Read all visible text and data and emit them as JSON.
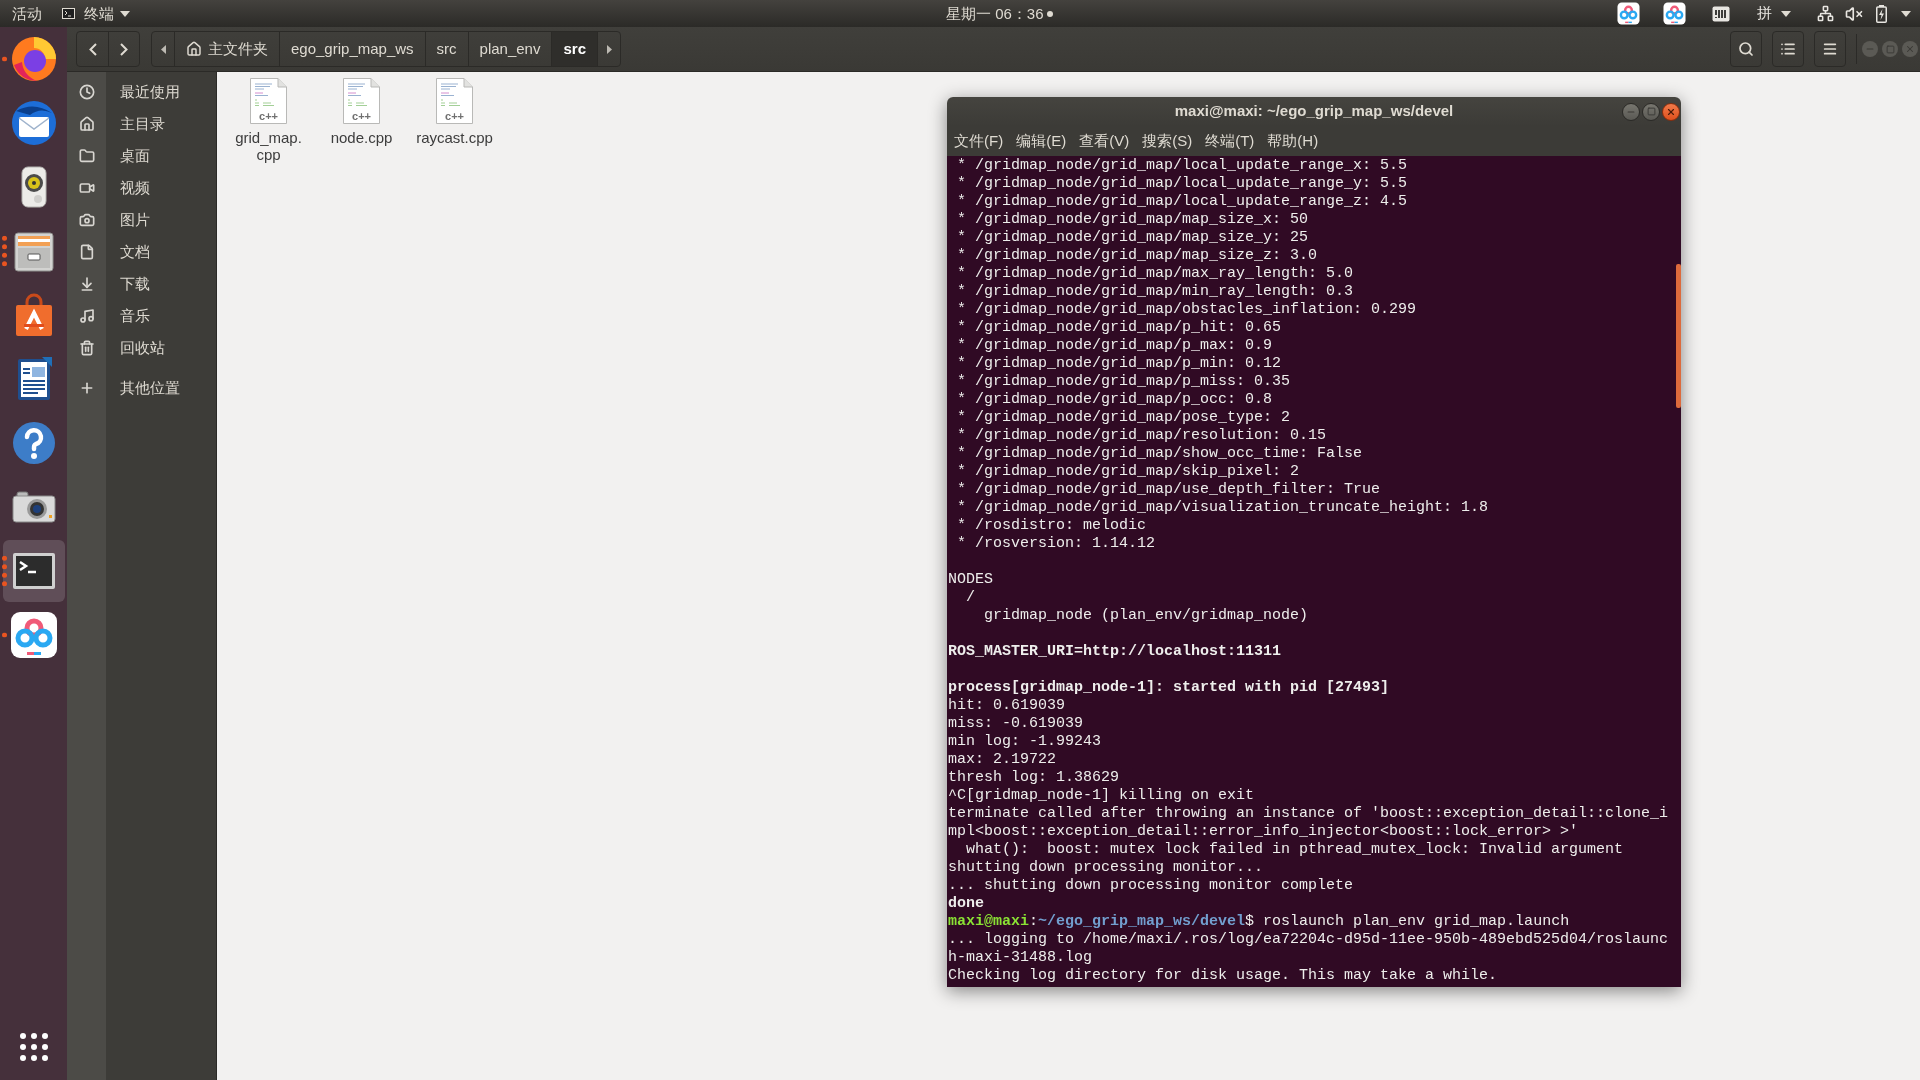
{
  "top_bar": {
    "activities": "活动",
    "app_menu": "终端",
    "clock": "星期一 06：36",
    "input_method": "拼"
  },
  "dock": {
    "apps": [
      {
        "kind": "browser",
        "running": true,
        "several_windows": false,
        "selected": false
      },
      {
        "kind": "mail",
        "running": false,
        "several_windows": false,
        "selected": false
      },
      {
        "kind": "music",
        "running": false,
        "several_windows": false,
        "selected": false
      },
      {
        "kind": "files",
        "running": true,
        "several_windows": true,
        "selected": false
      },
      {
        "kind": "software",
        "running": false,
        "several_windows": false,
        "selected": false
      },
      {
        "kind": "writer",
        "running": false,
        "several_windows": false,
        "selected": false
      },
      {
        "kind": "help",
        "running": false,
        "several_windows": false,
        "selected": false
      },
      {
        "kind": "camera",
        "running": false,
        "several_windows": false,
        "selected": false
      },
      {
        "kind": "terminal",
        "running": true,
        "several_windows": true,
        "selected": true
      },
      {
        "kind": "netdisk",
        "running": true,
        "several_windows": false,
        "selected": false
      }
    ]
  },
  "files_window": {
    "path": [
      {
        "label": "主文件夹",
        "kind": "home",
        "selected": false
      },
      {
        "label": "ego_grip_map_ws",
        "kind": "folder",
        "selected": false
      },
      {
        "label": "src",
        "kind": "folder",
        "selected": false
      },
      {
        "label": "plan_env",
        "kind": "folder",
        "selected": false
      },
      {
        "label": "src",
        "kind": "folder",
        "selected": true
      }
    ],
    "sidebar": {
      "items": [
        {
          "label": "最近使用",
          "kind": "recent",
          "selected": false
        },
        {
          "label": "主目录",
          "kind": "home",
          "selected": false
        },
        {
          "label": "桌面",
          "kind": "desktop",
          "selected": false
        },
        {
          "label": "视频",
          "kind": "videos",
          "selected": false
        },
        {
          "label": "图片",
          "kind": "pictures",
          "selected": false
        },
        {
          "label": "文档",
          "kind": "documents",
          "selected": false
        },
        {
          "label": "下载",
          "kind": "downloads",
          "selected": false
        },
        {
          "label": "音乐",
          "kind": "music",
          "selected": false
        },
        {
          "label": "回收站",
          "kind": "trash",
          "selected": false
        }
      ],
      "other_locations": {
        "label": "其他位置",
        "kind": "other",
        "selected": false
      }
    },
    "files": [
      {
        "name": "grid_map.cpp",
        "type_label": "c++"
      },
      {
        "name": "node.cpp",
        "type_label": "c++"
      },
      {
        "name": "raycast.cpp",
        "type_label": "c++"
      }
    ]
  },
  "terminal": {
    "title": "maxi@maxi: ~/ego_grip_map_ws/devel",
    "menu": [
      "文件(F)",
      "编辑(E)",
      "查看(V)",
      "搜索(S)",
      "终端(T)",
      "帮助(H)"
    ],
    "blocks": [
      [
        {
          "kind": "output",
          "text": " * /gridmap_node/grid_map/local_update_range_x: 5.5",
          "bold": false
        },
        {
          "kind": "output",
          "text": " * /gridmap_node/grid_map/local_update_range_y: 5.5",
          "bold": false
        },
        {
          "kind": "output",
          "text": " * /gridmap_node/grid_map/local_update_range_z: 4.5",
          "bold": false
        },
        {
          "kind": "output",
          "text": " * /gridmap_node/grid_map/map_size_x: 50",
          "bold": false
        },
        {
          "kind": "output",
          "text": " * /gridmap_node/grid_map/map_size_y: 25",
          "bold": false
        },
        {
          "kind": "output",
          "text": " * /gridmap_node/grid_map/map_size_z: 3.0",
          "bold": false
        },
        {
          "kind": "output",
          "text": " * /gridmap_node/grid_map/max_ray_length: 5.0",
          "bold": false
        },
        {
          "kind": "output",
          "text": " * /gridmap_node/grid_map/min_ray_length: 0.3",
          "bold": false
        },
        {
          "kind": "output",
          "text": " * /gridmap_node/grid_map/obstacles_inflation: 0.299",
          "bold": false
        },
        {
          "kind": "output",
          "text": " * /gridmap_node/grid_map/p_hit: 0.65",
          "bold": false
        },
        {
          "kind": "output",
          "text": " * /gridmap_node/grid_map/p_max: 0.9",
          "bold": false
        },
        {
          "kind": "output",
          "text": " * /gridmap_node/grid_map/p_min: 0.12",
          "bold": false
        },
        {
          "kind": "output",
          "text": " * /gridmap_node/grid_map/p_miss: 0.35",
          "bold": false
        },
        {
          "kind": "output",
          "text": " * /gridmap_node/grid_map/p_occ: 0.8",
          "bold": false
        },
        {
          "kind": "output",
          "text": " * /gridmap_node/grid_map/pose_type: 2",
          "bold": false
        },
        {
          "kind": "output",
          "text": " * /gridmap_node/grid_map/resolution: 0.15",
          "bold": false
        },
        {
          "kind": "output",
          "text": " * /gridmap_node/grid_map/show_occ_time: False",
          "bold": false
        },
        {
          "kind": "output",
          "text": " * /gridmap_node/grid_map/skip_pixel: 2",
          "bold": false
        },
        {
          "kind": "output",
          "text": " * /gridmap_node/grid_map/use_depth_filter: True",
          "bold": false
        },
        {
          "kind": "output",
          "text": " * /gridmap_node/grid_map/visualization_truncate_height: 1.8",
          "bold": false
        },
        {
          "kind": "output",
          "text": " * /rosdistro: melodic",
          "bold": false
        },
        {
          "kind": "output",
          "text": " * /rosversion: 1.14.12",
          "bold": false
        }
      ],
      [
        {
          "kind": "output",
          "text": "NODES",
          "bold": false,
          "children": [
            {
              "kind": "output",
              "text": "/",
              "bold": false,
              "children": [
                {
                  "kind": "output",
                  "text": "gridmap_node (plan_env/gridmap_node)",
                  "bold": false
                }
              ]
            }
          ]
        }
      ],
      [
        {
          "kind": "output",
          "text": "ROS_MASTER_URI=http://localhost:11311",
          "bold": true
        }
      ],
      [
        {
          "kind": "output",
          "text": "process[gridmap_node-1]: started with pid [27493]",
          "bold": true
        },
        {
          "kind": "output",
          "text": "hit: 0.619039",
          "bold": false
        },
        {
          "kind": "output",
          "text": "miss: -0.619039",
          "bold": false
        },
        {
          "kind": "output",
          "text": "min log: -1.99243",
          "bold": false
        },
        {
          "kind": "output",
          "text": "max: 2.19722",
          "bold": false
        },
        {
          "kind": "output",
          "text": "thresh log: 1.38629",
          "bold": false
        },
        {
          "kind": "output",
          "text": "^C[gridmap_node-1] killing on exit",
          "bold": false
        },
        {
          "kind": "output",
          "text": "terminate called after throwing an instance of 'boost::exception_detail::clone_impl<boost::exception_detail::error_info_injector<boost::lock_error> >'",
          "bold": false,
          "children": [
            {
              "kind": "output",
              "text": "what():  boost: mutex lock failed in pthread_mutex_lock: Invalid argument",
              "bold": false
            }
          ]
        },
        {
          "kind": "output",
          "text": "shutting down processing monitor...",
          "bold": false
        },
        {
          "kind": "output",
          "text": "... shutting down processing monitor complete",
          "bold": false
        },
        {
          "kind": "output",
          "text": "done",
          "bold": true
        },
        {
          "kind": "prompt",
          "user": "maxi@maxi",
          "separator": ":",
          "path": "~/ego_grip_map_ws/devel",
          "command": "$ roslaunch plan_env grid_map.launch"
        },
        {
          "kind": "output",
          "text": "... logging to /home/maxi/.ros/log/ea72204c-d95d-11ee-950b-489ebd525d04/roslaunch-maxi-31488.log",
          "bold": false
        },
        {
          "kind": "output",
          "text": "Checking log directory for disk usage. This may take a while.",
          "bold": false
        }
      ]
    ]
  }
}
